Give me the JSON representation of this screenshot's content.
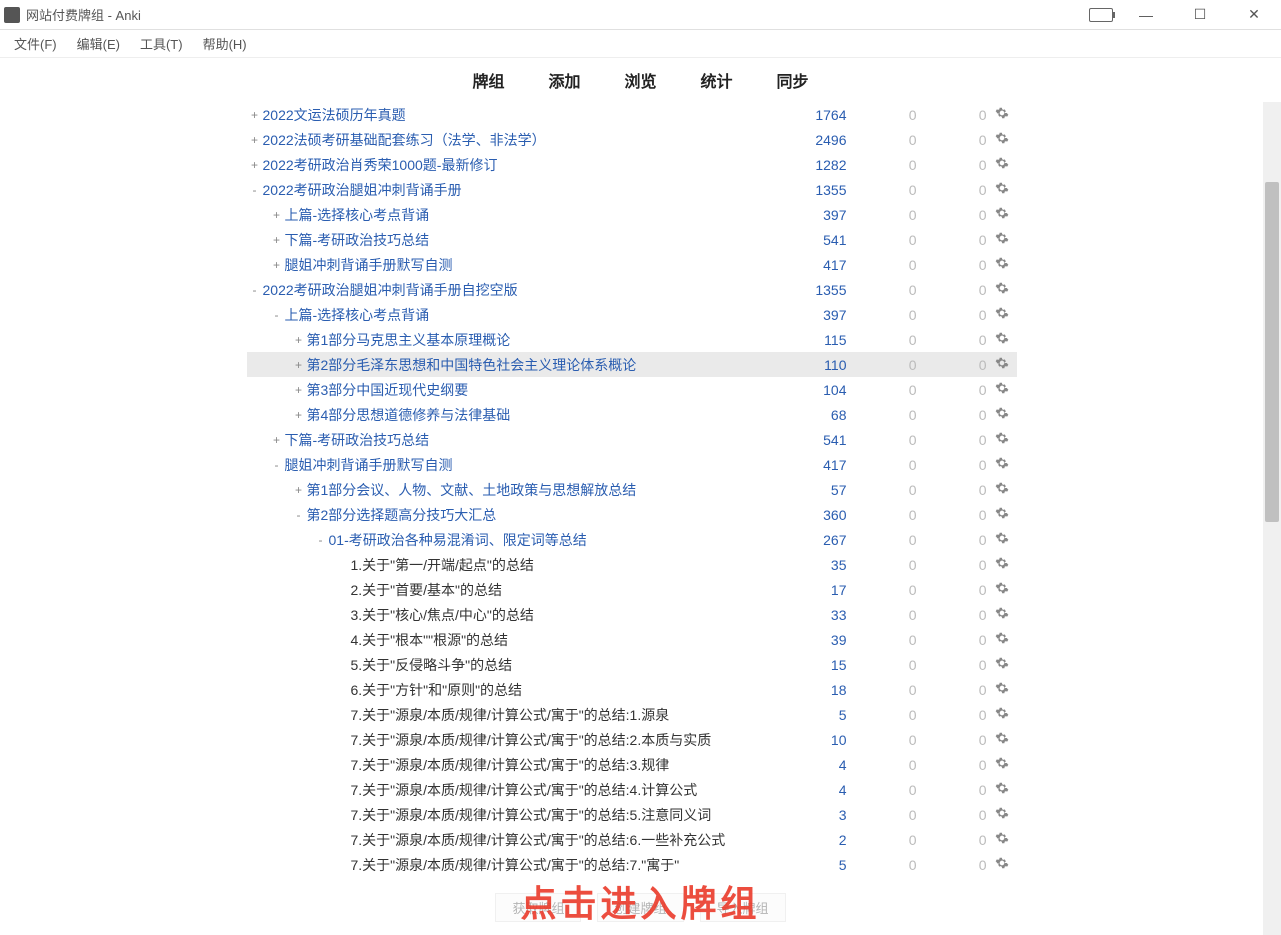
{
  "window": {
    "title": "网站付费牌组 - Anki"
  },
  "menu": {
    "file": "文件(F)",
    "edit": "编辑(E)",
    "tools": "工具(T)",
    "help": "帮助(H)"
  },
  "toolbar": {
    "decks": "牌组",
    "add": "添加",
    "browse": "浏览",
    "stats": "统计",
    "sync": "同步"
  },
  "footer": {
    "get": "获取牌组",
    "create": "创建牌组",
    "import": "导入牌组"
  },
  "overlay": "点击进入牌组",
  "decks": [
    {
      "depth": 0,
      "toggle": "+",
      "name": "2022文运法硕历年真题",
      "new": "1764",
      "learn": "0",
      "due": "0"
    },
    {
      "depth": 0,
      "toggle": "+",
      "name": "2022法硕考研基础配套练习（法学、非法学）",
      "new": "2496",
      "learn": "0",
      "due": "0"
    },
    {
      "depth": 0,
      "toggle": "+",
      "name": "2022考研政治肖秀荣1000题-最新修订",
      "new": "1282",
      "learn": "0",
      "due": "0"
    },
    {
      "depth": 0,
      "toggle": "-",
      "name": "2022考研政治腿姐冲刺背诵手册",
      "new": "1355",
      "learn": "0",
      "due": "0"
    },
    {
      "depth": 1,
      "toggle": "+",
      "name": "上篇-选择核心考点背诵",
      "new": "397",
      "learn": "0",
      "due": "0"
    },
    {
      "depth": 1,
      "toggle": "+",
      "name": "下篇-考研政治技巧总结",
      "new": "541",
      "learn": "0",
      "due": "0"
    },
    {
      "depth": 1,
      "toggle": "+",
      "name": "腿姐冲刺背诵手册默写自测",
      "new": "417",
      "learn": "0",
      "due": "0"
    },
    {
      "depth": 0,
      "toggle": "-",
      "name": "2022考研政治腿姐冲刺背诵手册自挖空版",
      "new": "1355",
      "learn": "0",
      "due": "0"
    },
    {
      "depth": 1,
      "toggle": "-",
      "name": "上篇-选择核心考点背诵",
      "new": "397",
      "learn": "0",
      "due": "0"
    },
    {
      "depth": 2,
      "toggle": "+",
      "name": "第1部分马克思主义基本原理概论",
      "new": "115",
      "learn": "0",
      "due": "0"
    },
    {
      "depth": 2,
      "toggle": "+",
      "name": "第2部分毛泽东思想和中国特色社会主义理论体系概论",
      "new": "110",
      "learn": "0",
      "due": "0",
      "highlight": true
    },
    {
      "depth": 2,
      "toggle": "+",
      "name": "第3部分中国近现代史纲要",
      "new": "104",
      "learn": "0",
      "due": "0"
    },
    {
      "depth": 2,
      "toggle": "+",
      "name": "第4部分思想道德修养与法律基础",
      "new": "68",
      "learn": "0",
      "due": "0"
    },
    {
      "depth": 1,
      "toggle": "+",
      "name": "下篇-考研政治技巧总结",
      "new": "541",
      "learn": "0",
      "due": "0"
    },
    {
      "depth": 1,
      "toggle": "-",
      "name": "腿姐冲刺背诵手册默写自测",
      "new": "417",
      "learn": "0",
      "due": "0"
    },
    {
      "depth": 2,
      "toggle": "+",
      "name": "第1部分会议、人物、文献、土地政策与思想解放总结",
      "new": "57",
      "learn": "0",
      "due": "0"
    },
    {
      "depth": 2,
      "toggle": "-",
      "name": "第2部分选择题高分技巧大汇总",
      "new": "360",
      "learn": "0",
      "due": "0"
    },
    {
      "depth": 3,
      "toggle": "-",
      "name": "01-考研政治各种易混淆词、限定词等总结",
      "new": "267",
      "learn": "0",
      "due": "0"
    },
    {
      "depth": 4,
      "toggle": "",
      "name": "1.关于\"第一/开端/起点\"的总结",
      "new": "35",
      "learn": "0",
      "due": "0",
      "plain": true
    },
    {
      "depth": 4,
      "toggle": "",
      "name": "2.关于\"首要/基本\"的总结",
      "new": "17",
      "learn": "0",
      "due": "0",
      "plain": true
    },
    {
      "depth": 4,
      "toggle": "",
      "name": "3.关于\"核心/焦点/中心\"的总结",
      "new": "33",
      "learn": "0",
      "due": "0",
      "plain": true
    },
    {
      "depth": 4,
      "toggle": "",
      "name": "4.关于\"根本\"\"根源\"的总结",
      "new": "39",
      "learn": "0",
      "due": "0",
      "plain": true
    },
    {
      "depth": 4,
      "toggle": "",
      "name": "5.关于\"反侵略斗争\"的总结",
      "new": "15",
      "learn": "0",
      "due": "0",
      "plain": true
    },
    {
      "depth": 4,
      "toggle": "",
      "name": "6.关于\"方针\"和\"原则\"的总结",
      "new": "18",
      "learn": "0",
      "due": "0",
      "plain": true
    },
    {
      "depth": 4,
      "toggle": "",
      "name": "7.关于\"源泉/本质/规律/计算公式/寓于\"的总结:1.源泉",
      "new": "5",
      "learn": "0",
      "due": "0",
      "plain": true
    },
    {
      "depth": 4,
      "toggle": "",
      "name": "7.关于\"源泉/本质/规律/计算公式/寓于\"的总结:2.本质与实质",
      "new": "10",
      "learn": "0",
      "due": "0",
      "plain": true
    },
    {
      "depth": 4,
      "toggle": "",
      "name": "7.关于\"源泉/本质/规律/计算公式/寓于\"的总结:3.规律",
      "new": "4",
      "learn": "0",
      "due": "0",
      "plain": true
    },
    {
      "depth": 4,
      "toggle": "",
      "name": "7.关于\"源泉/本质/规律/计算公式/寓于\"的总结:4.计算公式",
      "new": "4",
      "learn": "0",
      "due": "0",
      "plain": true
    },
    {
      "depth": 4,
      "toggle": "",
      "name": "7.关于\"源泉/本质/规律/计算公式/寓于\"的总结:5.注意同义词",
      "new": "3",
      "learn": "0",
      "due": "0",
      "plain": true
    },
    {
      "depth": 4,
      "toggle": "",
      "name": "7.关于\"源泉/本质/规律/计算公式/寓于\"的总结:6.一些补充公式",
      "new": "2",
      "learn": "0",
      "due": "0",
      "plain": true
    },
    {
      "depth": 4,
      "toggle": "",
      "name": "7.关于\"源泉/本质/规律/计算公式/寓于\"的总结:7.\"寓于\"",
      "new": "5",
      "learn": "0",
      "due": "0",
      "plain": true
    }
  ]
}
